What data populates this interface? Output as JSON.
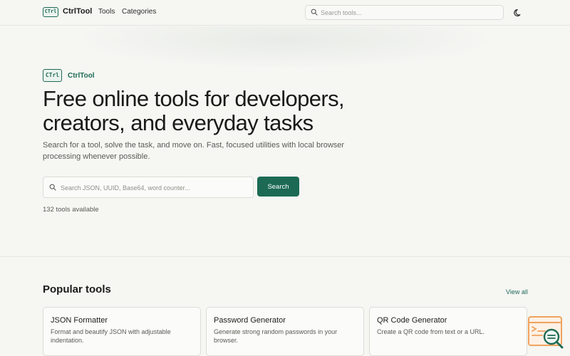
{
  "header": {
    "brand_badge": "CTrl",
    "brand_name": "CtrlTool",
    "nav": [
      {
        "label": "Tools"
      },
      {
        "label": "Categories"
      }
    ],
    "search_placeholder": "Search tools...",
    "theme_icon": "moon-icon"
  },
  "hero": {
    "badge": "CTrl",
    "brand": "CtrlTool",
    "title": "Free online tools for developers, creators, and everyday tasks",
    "subtitle": "Search for a tool, solve the task, and move on. Fast, focused utilities with local browser processing whenever possible.",
    "search_placeholder": "Search JSON, UUID, Base64, word counter...",
    "search_button": "Search",
    "tools_count": "132 tools available"
  },
  "popular": {
    "title": "Popular tools",
    "view_all": "View all",
    "cards": [
      {
        "title": "JSON Formatter",
        "desc": "Format and beautify JSON with adjustable indentation."
      },
      {
        "title": "Password Generator",
        "desc": "Generate strong random passwords in your browser."
      },
      {
        "title": "QR Code Generator",
        "desc": "Create a QR code from text or a URL."
      }
    ]
  },
  "colors": {
    "accent": "#1c6a54",
    "background": "#f6f6f3",
    "widget_orange": "#f0a35e"
  }
}
